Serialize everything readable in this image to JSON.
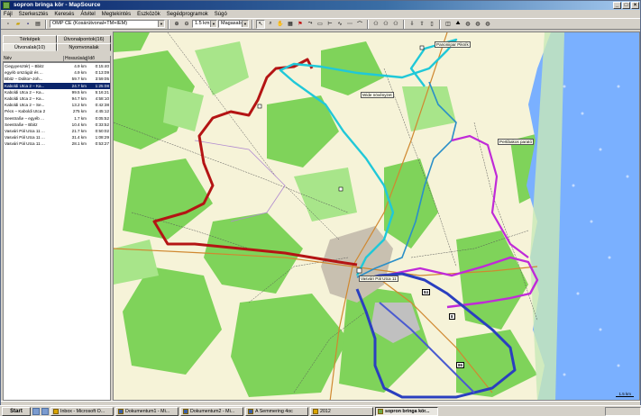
{
  "window": {
    "title": "sopron bringa kör - MapSource"
  },
  "menu": [
    "Fájl",
    "Szerkesztés",
    "Keresés",
    "Átvitel",
    "Megtekintés",
    "Eszközök",
    "Segédprogramok",
    "Súgó"
  ],
  "toolbar": {
    "map_product": "OMP CE (Kosárútvonal+TM+IEM)",
    "zoom": "1.5 km",
    "detail": "Magasabb"
  },
  "tabs": {
    "row1": [
      "Térképek",
      "Útvonalpontok(16)"
    ],
    "row2": [
      "Útvonalak(10)",
      "Nyomvonalak"
    ]
  },
  "list_columns": [
    "Név",
    "Hosszúság",
    "Idő"
  ],
  "routes": [
    {
      "name": "Ciegyyenztér) – Bbitz",
      "length": "4.9 km",
      "time": "0:15:40"
    },
    {
      "name": "egyéb országút és ...",
      "length": "4.9 km",
      "time": "0:13:09"
    },
    {
      "name": "Bbitz – Dolitor–Joh...",
      "length": "59.7 km",
      "time": "3:59:05"
    },
    {
      "name": "Kaboldi Utca 2 – Ka...",
      "length": "24.7 km",
      "time": "1:25:08"
    },
    {
      "name": "Kaboldi Utca 2 – Ka...",
      "length": "99.5 km",
      "time": "5:16:21"
    },
    {
      "name": "Kaboldi Utca 2 – Ka...",
      "length": "94.7 km",
      "time": "4:58:10"
    },
    {
      "name": "Kaboldi Utca 2 – Se...",
      "length": "13.2 km",
      "time": "0:42:38"
    },
    {
      "name": "Pécs – Kaboldi Utca 2",
      "length": "275 km",
      "time": "4:45:12"
    },
    {
      "name": "Seestraße – egyéb ...",
      "length": "1.7 km",
      "time": "0:05:52"
    },
    {
      "name": "Seestraße – Bbitz",
      "length": "10.4 km",
      "time": "0:33:52"
    },
    {
      "name": "Vasvári Pál Utca 11 ...",
      "length": "21.7 km",
      "time": "0:50:02"
    },
    {
      "name": "Vasvári Pál Utca 11 ...",
      "length": "31.4 km",
      "time": "1:08:29"
    },
    {
      "name": "Vasvári Pál Utca 11 ...",
      "length": "28.1 km",
      "time": "0:53:27"
    }
  ],
  "selected_route_index": 3,
  "map_labels": {
    "pannonipar": "Panoniipar Pikník",
    "nadas": "Wide növényzet",
    "pertiba": "Pertibakos parató",
    "vasvari": "Vasvári Pál Utca 11",
    "b84": "84",
    "b8": "8",
    "b86": "86",
    "scale": "1.5 km"
  },
  "taskbar": {
    "start": "Start",
    "tasks": [
      "Inbox - Microsoft O...",
      "Dokumentum1 - Mi...",
      "Dokumentum2 - Mi...",
      "A Semmering 4oc",
      "2012",
      "sopron bringa kör..."
    ],
    "active_task_index": 5
  },
  "colors": {
    "route_red": "#b41414",
    "route_cyan": "#20c8d8",
    "route_blue": "#2a3fbf",
    "route_magenta": "#c02ad8",
    "forest": "#7fd35a",
    "lake": "#7ab0ff"
  }
}
